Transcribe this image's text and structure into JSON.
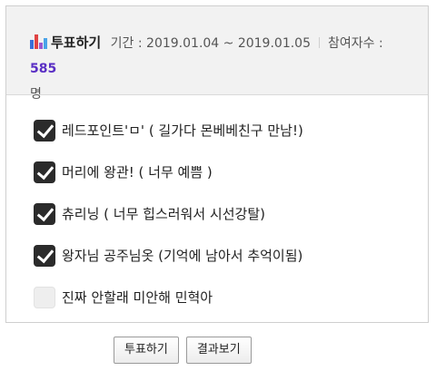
{
  "poll": {
    "title": "투표하기",
    "period_label": "기간 : ",
    "period": "2019.01.04 ~ 2019.01.05",
    "participants_label": "참여자수 : ",
    "participants_count": "585",
    "participants_unit": "명"
  },
  "options": [
    {
      "label": "레드포인트'ㅁ' ( 길가다 몬베베친구 만남!)",
      "checked": true
    },
    {
      "label": "머리에 왕관! ( 너무 예쁨 )",
      "checked": true
    },
    {
      "label": "츄리닝 ( 너무 힙스러워서 시선강탈)",
      "checked": true
    },
    {
      "label": "왕자님 공주님옷 (기억에 남아서 추억이됨)",
      "checked": true
    },
    {
      "label": "진짜 안할래 미안해 민혁아",
      "checked": false
    }
  ],
  "buttons": {
    "vote": "투표하기",
    "results": "결과보기"
  },
  "colors": {
    "count": "#5a2fc4",
    "checkbox_checked": "#2b2b2b",
    "header_bg": "#f2f2f2"
  },
  "icons": {
    "poll_icon": "bar-chart-icon",
    "checked": "checkmark-icon"
  }
}
